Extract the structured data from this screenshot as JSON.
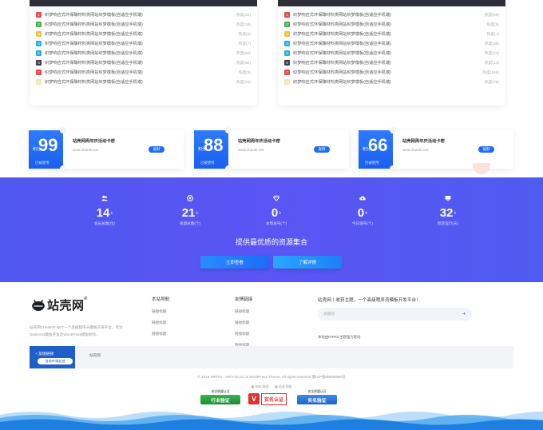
{
  "ranks": {
    "left": [
      {
        "n": "1",
        "color": "#e54b4b",
        "title": "织梦响应式环保酵材料类网站织梦模板(自适应手机端)",
        "heat": "热度(26)"
      },
      {
        "n": "2",
        "color": "#4caf50",
        "title": "织梦响应式环保酵材料类网站织梦模板(自适应手机端)",
        "heat": "热度(18)"
      },
      {
        "n": "3",
        "color": "#f0c23b",
        "title": "织梦响应式环保酵材料类网站织梦模板(自适应手机端)",
        "heat": "热度(6)"
      },
      {
        "n": "4",
        "color": "#25b1e0",
        "title": "织梦响应式环保酵材料类网站织梦模板(自适应手机端)",
        "heat": "热度(7)"
      },
      {
        "n": "5",
        "color": "#25b1e0",
        "title": "织梦响应式环保酵材料类网站织梦模板(自适应手机端)",
        "heat": "热度(50)"
      },
      {
        "n": "6",
        "color": "#3a3d4a",
        "title": "织梦响应式环保酵材料类网站织梦模板(自适应手机端)",
        "heat": "热度(69)"
      },
      {
        "n": "7",
        "color": "#e54b4b",
        "title": "织梦响应式环保酵材料类网站织梦模板(自适应手机端)",
        "heat": "热度(9)"
      },
      {
        "n": "8",
        "color": "#f3e7b0",
        "title": "织梦响应式环保酵材料类网站织梦模板(自适应手机端)",
        "heat": "热度(33)"
      }
    ],
    "right": [
      {
        "n": "1",
        "color": "#e54b4b",
        "title": "织梦响应式环保酵材料类网站织梦模板(自适应手机端)",
        "heat": "热度(88)"
      },
      {
        "n": "2",
        "color": "#4caf50",
        "title": "织梦响应式环保酵材料类网站织梦模板(自适应手机端)",
        "heat": "热度(5)"
      },
      {
        "n": "3",
        "color": "#f0c23b",
        "title": "织梦响应式环保酵材料类网站织梦模板(自适应手机端)",
        "heat": "热度(7)"
      },
      {
        "n": "4",
        "color": "#25b1e0",
        "title": "织梦响应式环保酵材料类网站织梦模板(自适应手机端)",
        "heat": "热度(38)"
      },
      {
        "n": "5",
        "color": "#25b1e0",
        "title": "织梦响应式环保酵材料类网站织梦模板(自适应手机端)",
        "heat": "热度(23)"
      },
      {
        "n": "6",
        "color": "#3a3d4a",
        "title": "织梦响应式环保酵材料类网站织梦模板(自适应手机端)",
        "heat": "热度(14)"
      },
      {
        "n": "7",
        "color": "#e54b4b",
        "title": "织梦响应式环保酵材料类网站织梦模板(自适应手机端)",
        "heat": "热度(166)"
      },
      {
        "n": "8",
        "color": "#f3e7b0",
        "title": "织梦响应式环保酵材料类网站织梦模板(自适应手机端)",
        "heat": "热度(78)"
      }
    ]
  },
  "coupons": [
    {
      "prefix": "积分",
      "amount": "99",
      "tag": "已被使用",
      "title": "站壳网周年庆活动卡密",
      "url": "www.zhankr.net",
      "btn": "复制"
    },
    {
      "prefix": "积分",
      "amount": "88",
      "tag": "已被使用",
      "title": "站壳网周年庆活动卡密",
      "url": "www.zhankr.net",
      "btn": "复制"
    },
    {
      "prefix": "积分",
      "amount": "66",
      "tag": "已被使用",
      "title": "站壳网周年庆活动卡密",
      "url": "www.zhankr.net",
      "btn": "复制"
    }
  ],
  "stats": [
    {
      "icon": "users-icon",
      "value": "14",
      "label": "会员总数(位)"
    },
    {
      "icon": "resource-icon",
      "value": "21",
      "label": "资源总数(个)"
    },
    {
      "icon": "diamond-icon",
      "value": "0",
      "label": "本周发布(个)"
    },
    {
      "icon": "cloud-upload-icon",
      "value": "0",
      "label": "今日发布(个)"
    },
    {
      "icon": "monitor-icon",
      "value": "32",
      "label": "稳定运行(天)"
    }
  ],
  "stats_sup": "+",
  "slogan": "提供最优质的资源集合",
  "band_buttons": {
    "join": "立即查看",
    "learn": "了解详情"
  },
  "footer": {
    "logo_text": "站壳网",
    "logo_reg": "®",
    "about": "站壳网ZHANKR.NET一个高级程序员模板开发平台，专注Dedecms模板开发及WordPress模板制作。",
    "nav_title": "本站导航",
    "nav_links": [
      "链接标题",
      "链接标题",
      "链接标题"
    ],
    "friend_title": "友情链接",
    "friend_links": [
      "链接标题",
      "链接标题",
      "链接标题",
      "链接标题"
    ],
    "subscribe_text": "站壳网丨收获主题，一个高级程序员模板开发平台！",
    "email_placeholder": "关键词",
    "email_arrow": "➜",
    "subscribe_note": "本站由RIPRO主题强力驱动",
    "friend_tab_title": "+ 友情链接",
    "friend_apply": "自助申请友链",
    "friend_bar_link": "站壳网",
    "copyright": "© 2018 RIPRO - VIP.YIZI.CC & WordPress Theme. All rights reserved 蜀ICP备88888888号",
    "bottom_links": [
      "▦ XML地图",
      "▦ 站长导航"
    ],
    "badges": {
      "green_top": "安全联盟认证",
      "green_body": "行业验证",
      "red_mark": "V",
      "red_text": "实名认证",
      "blue_top": "安全联盟认证",
      "blue_body": "实名验证"
    }
  },
  "colors": {
    "brand_blue": "#1f6bff",
    "band": "#5057f0",
    "dark_head": "#2e2f3a"
  }
}
